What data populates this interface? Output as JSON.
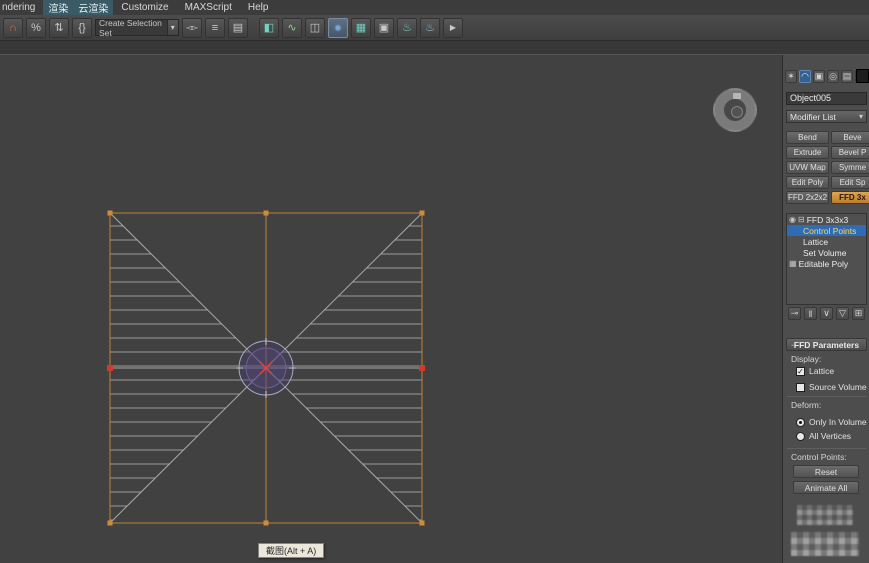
{
  "menubar": {
    "items": [
      "ndering",
      "渲染",
      "云渲染",
      "Customize",
      "MAXScript",
      "Help"
    ]
  },
  "toolbar": {
    "selection_set_value": "Create Selection Set"
  },
  "icons": {
    "snap_toggle": "∩",
    "percent_snap": "%",
    "spinner_snap": "⇅",
    "named_sets": "{}",
    "combo_arrow": "▾",
    "mirror": "◅▻",
    "align": "≡",
    "layer_manager": "▤",
    "ribbon": "◧",
    "curve_editor": "∿",
    "schematic_view": "◫",
    "material_editor": "●",
    "render_setup": "▦",
    "rendered_frame": "▣",
    "render_production": "♨",
    "render_iterative": "♨",
    "render_last": "▶",
    "tab_create": "✶",
    "tab_modify": "◠",
    "tab_hierarchy": "▣",
    "tab_motion": "◎",
    "tab_display": "▤",
    "tab_utilities": "✚",
    "dropdown_arrow": "▾",
    "bulb": "◉",
    "expand": "⊟",
    "editable_poly": "▦",
    "stack_pin": "⊸",
    "stack_show_end": "‖",
    "stack_make_unique": "∨",
    "stack_remove": "▽",
    "stack_configure": "⊞",
    "rollout_minus": "−",
    "checkbox_check": "✓"
  },
  "viewport": {
    "tooltip": "截图(Alt + A)"
  },
  "panel": {
    "object_name": "Object005",
    "modifier_list_label": "Modifier List",
    "modifier_buttons": [
      "Bend",
      "Beve",
      "Extrude",
      "Bevel P",
      "UVW Map",
      "Symme",
      "Edit Poly",
      "Edit Sp",
      "FFD 2x2x2",
      "FFD 3x"
    ],
    "stack_rows": [
      "FFD 3x3x3",
      "Control Points",
      "Lattice",
      "Set Volume",
      "Editable Poly"
    ],
    "ffd": {
      "title": "FFD Parameters",
      "display_label": "Display:",
      "lattice": "Lattice",
      "source_volume": "Source Volume",
      "deform_label": "Deform:",
      "only_in_volume": "Only In Volume",
      "all_vertices": "All Vertices",
      "control_points_label": "Control Points:",
      "reset": "Reset",
      "animate_all": "Animate All"
    }
  },
  "colors": {
    "accent_orange": "#c98a3c",
    "selection_blue": "#2e6db4",
    "subobject_yellow": "#ffd75e",
    "control_point_red": "#d23a2e",
    "wireframe_gray": "#a8a8a8"
  }
}
